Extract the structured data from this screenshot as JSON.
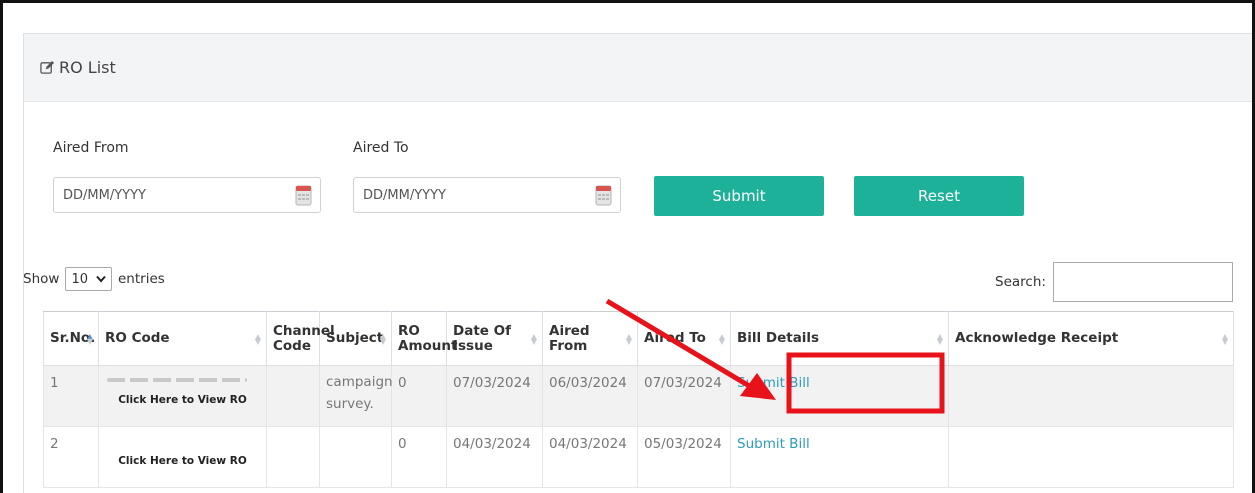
{
  "panel": {
    "title": "RO List",
    "icon": "edit-icon"
  },
  "filters": {
    "aired_from_label": "Aired From",
    "aired_from_placeholder": "DD/MM/YYYY",
    "aired_to_label": "Aired To",
    "aired_to_placeholder": "DD/MM/YYYY",
    "submit_label": "Submit",
    "reset_label": "Reset",
    "button_color": "#1eb199"
  },
  "table_controls": {
    "show_label": "Show",
    "page_size": "10",
    "entries_label": "entries",
    "search_label": "Search:"
  },
  "table": {
    "headers": [
      "Sr.No.",
      "RO Code",
      "Channel Code",
      "Subject",
      "RO Amount",
      "Date Of Issue",
      "Aired From",
      "Aired To",
      "Bill Details",
      "Acknowledge Receipt"
    ],
    "rows": [
      {
        "sr": "1",
        "view_ro": "Click Here to View RO",
        "channel_code": "",
        "subject": "campaign survey.",
        "amount": "0",
        "date_of_issue": "07/03/2024",
        "aired_from": "06/03/2024",
        "aired_to": "07/03/2024",
        "bill": "Submit Bill",
        "ack": ""
      },
      {
        "sr": "2",
        "view_ro": "Click Here to View RO",
        "channel_code": "",
        "subject": "",
        "amount": "0",
        "date_of_issue": "04/03/2024",
        "aired_from": "04/03/2024",
        "aired_to": "05/03/2024",
        "bill": "Submit Bill",
        "ack": ""
      }
    ]
  },
  "annotation": {
    "color": "#e8131a",
    "highlight": "Submit Bill"
  }
}
